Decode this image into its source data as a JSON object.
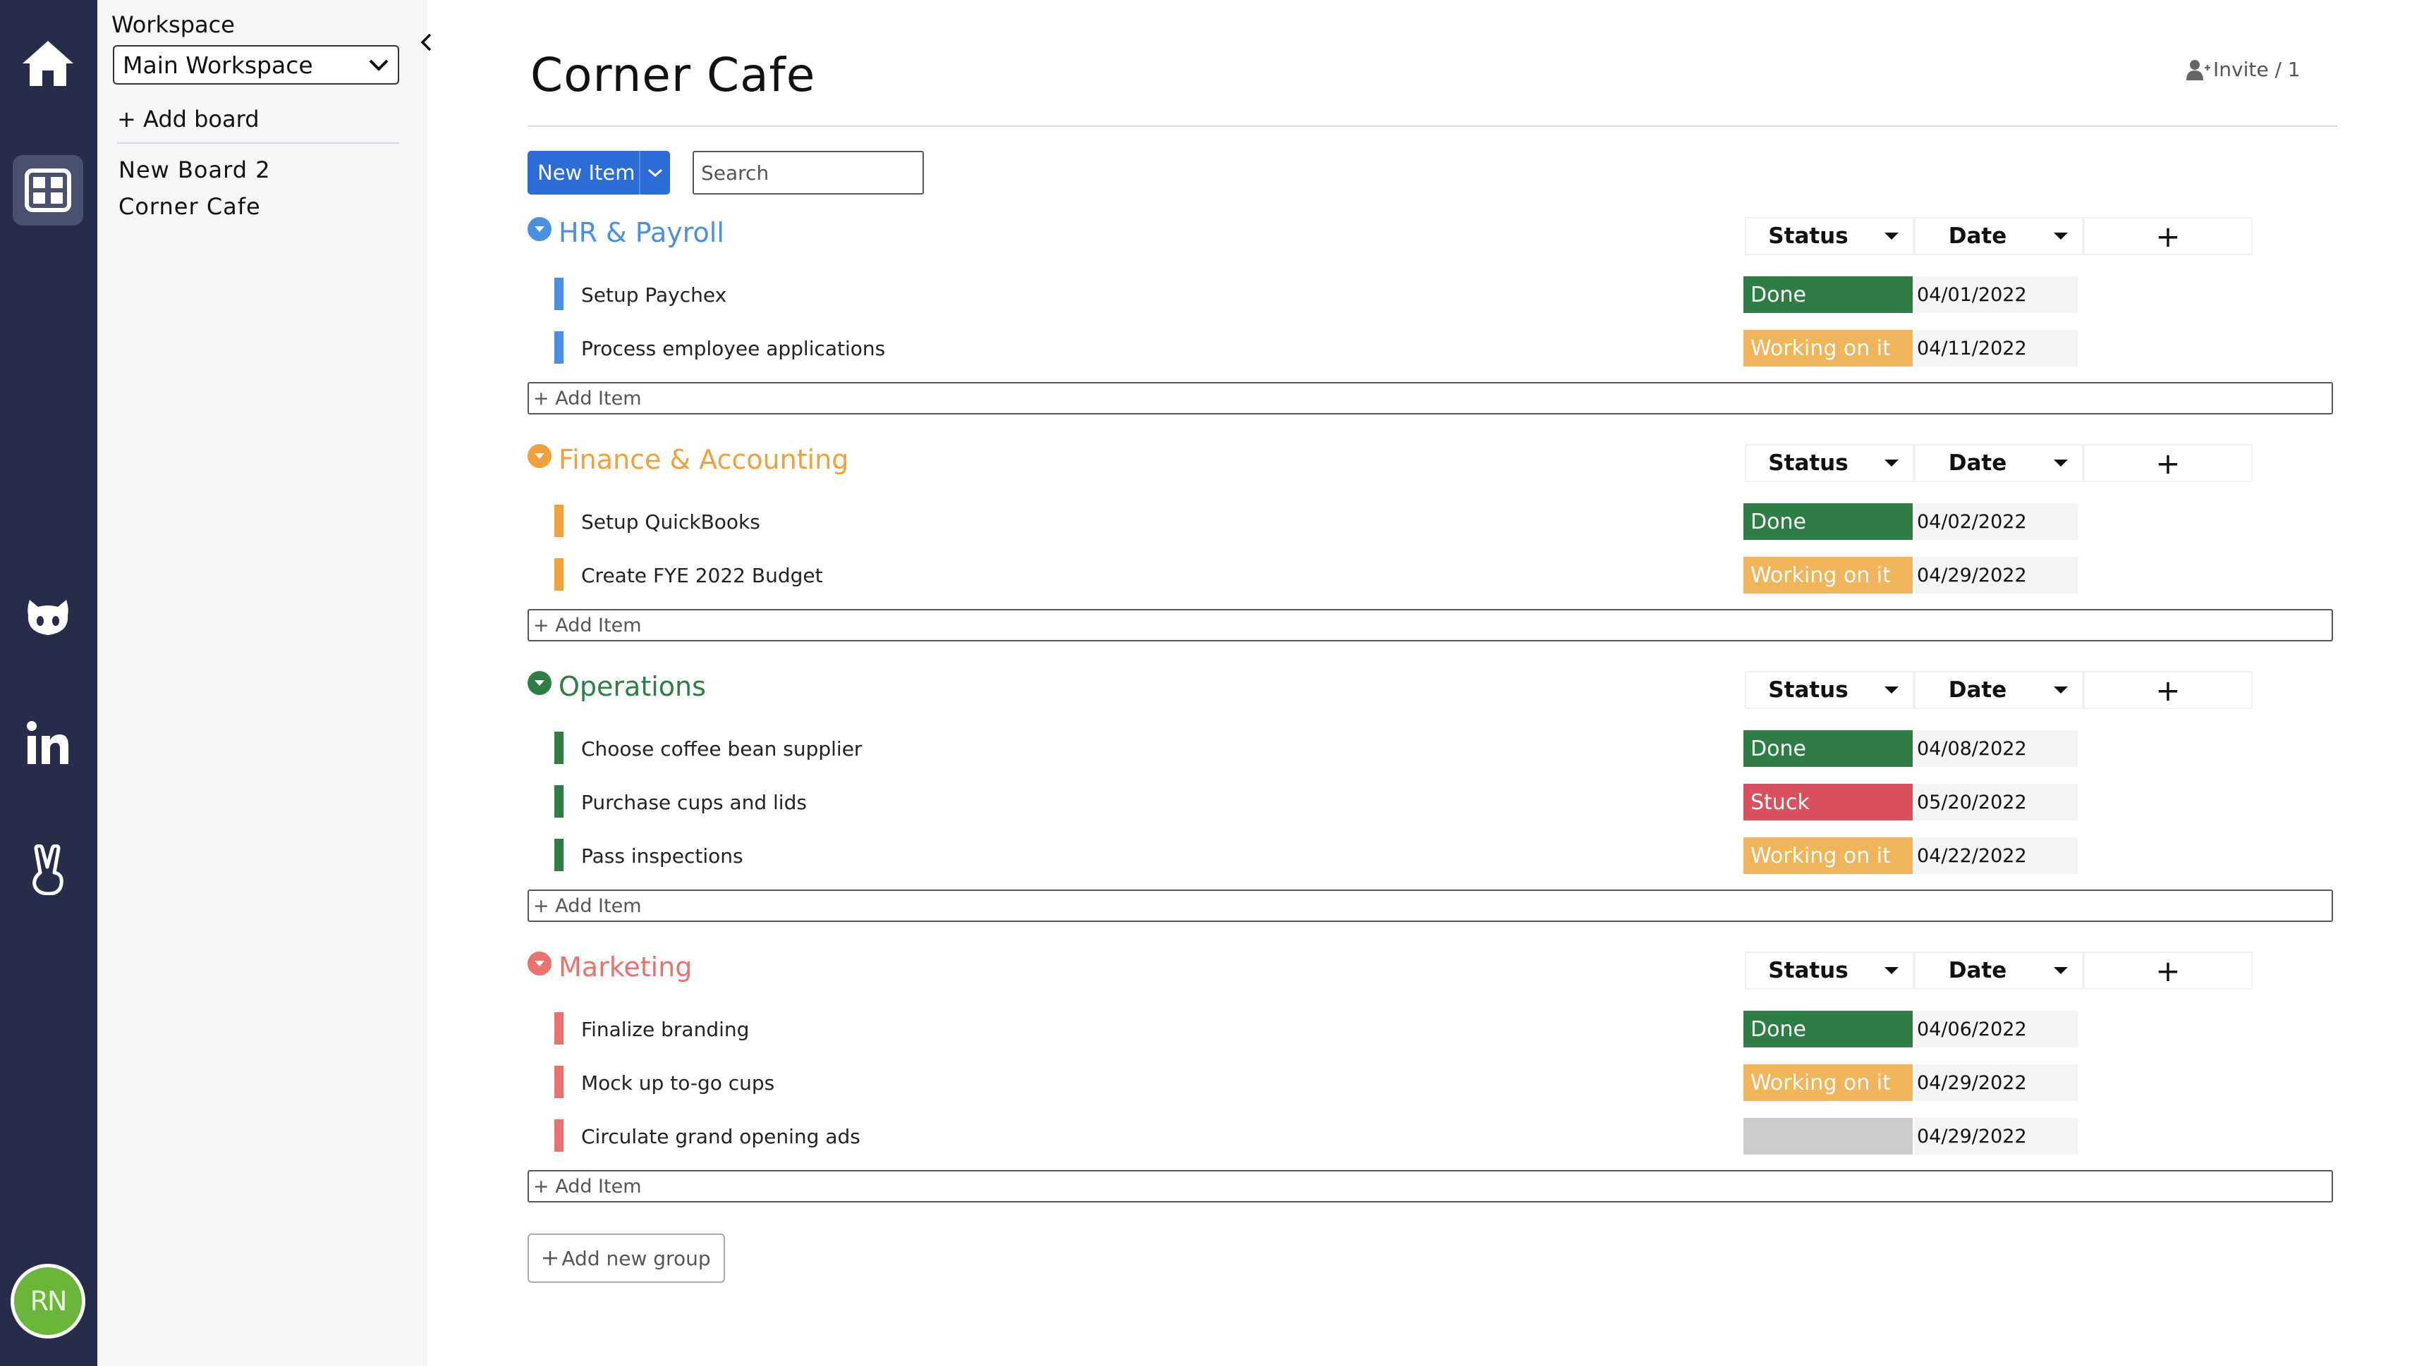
{
  "colors": {
    "rail": "#272c4a",
    "blue": "#4a90e2",
    "orange": "#f0a13c",
    "green": "#2e7d45",
    "red": "#e8726e",
    "status_done": "#2e7d45",
    "status_working": "#f0b45a",
    "status_stuck": "#d9505e",
    "status_empty": "#cccccc"
  },
  "rail": {
    "icons": [
      "home-icon",
      "boards-icon",
      "github-icon",
      "linkedin-icon",
      "angellist-icon"
    ],
    "avatar_initials": "RN"
  },
  "workspace": {
    "label": "Workspace",
    "selected": "Main Workspace",
    "add_board": "+ Add board",
    "boards": [
      "New Board 2",
      "Corner Cafe"
    ]
  },
  "board": {
    "title": "Corner Cafe",
    "invite": "Invite / 1",
    "new_item": "New Item",
    "search_placeholder": "Search",
    "add_group": "Add new group"
  },
  "columns": {
    "status": "Status",
    "date": "Date",
    "add": "+"
  },
  "add_item_label": "+ Add Item",
  "groups": [
    {
      "title": "HR & Payroll",
      "color": "#4a90e2",
      "items": [
        {
          "name": "Setup Paychex",
          "status": "Done",
          "status_color": "#2e7d45",
          "date": "04/01/2022"
        },
        {
          "name": "Process employee applications",
          "status": "Working on it",
          "status_color": "#f0b45a",
          "date": "04/11/2022"
        }
      ]
    },
    {
      "title": "Finance & Accounting",
      "color": "#f0a13c",
      "items": [
        {
          "name": "Setup QuickBooks",
          "status": "Done",
          "status_color": "#2e7d45",
          "date": "04/02/2022"
        },
        {
          "name": "Create FYE 2022 Budget",
          "status": "Working on it",
          "status_color": "#f0b45a",
          "date": "04/29/2022"
        }
      ]
    },
    {
      "title": "Operations",
      "color": "#2e7d45",
      "items": [
        {
          "name": "Choose coffee bean supplier",
          "status": "Done",
          "status_color": "#2e7d45",
          "date": "04/08/2022"
        },
        {
          "name": "Purchase cups and lids",
          "status": "Stuck",
          "status_color": "#d9505e",
          "date": "05/20/2022"
        },
        {
          "name": "Pass inspections",
          "status": "Working on it",
          "status_color": "#f0b45a",
          "date": "04/22/2022"
        }
      ]
    },
    {
      "title": "Marketing",
      "color": "#e8726e",
      "items": [
        {
          "name": "Finalize branding",
          "status": "Done",
          "status_color": "#2e7d45",
          "date": "04/06/2022"
        },
        {
          "name": "Mock up to-go cups",
          "status": "Working on it",
          "status_color": "#f0b45a",
          "date": "04/29/2022"
        },
        {
          "name": "Circulate grand opening ads",
          "status": "",
          "status_color": "#cccccc",
          "date": "04/29/2022"
        }
      ]
    }
  ]
}
